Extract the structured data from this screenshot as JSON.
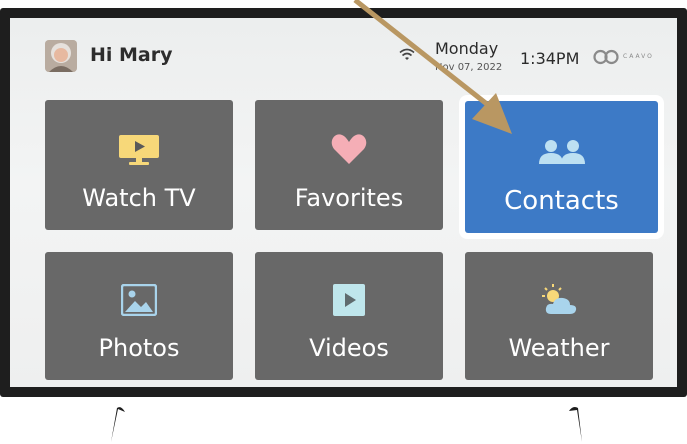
{
  "header": {
    "greeting": "Hi Mary",
    "day": "Monday",
    "date": "Nov 07, 2022",
    "time": "1:34PM",
    "brand": "CAAVO"
  },
  "tiles": [
    {
      "label": "Watch TV",
      "icon": "tv-icon",
      "selected": false
    },
    {
      "label": "Favorites",
      "icon": "heart-icon",
      "selected": false
    },
    {
      "label": "Contacts",
      "icon": "contacts-icon",
      "selected": true
    },
    {
      "label": "Photos",
      "icon": "photo-icon",
      "selected": false
    },
    {
      "label": "Videos",
      "icon": "video-play-icon",
      "selected": false
    },
    {
      "label": "Weather",
      "icon": "weather-icon",
      "selected": false
    }
  ],
  "colors": {
    "tile": "#686868",
    "selected_tile": "#3d7ac6",
    "arrow": "#b99762",
    "tv_frame": "#1e1e1e"
  }
}
